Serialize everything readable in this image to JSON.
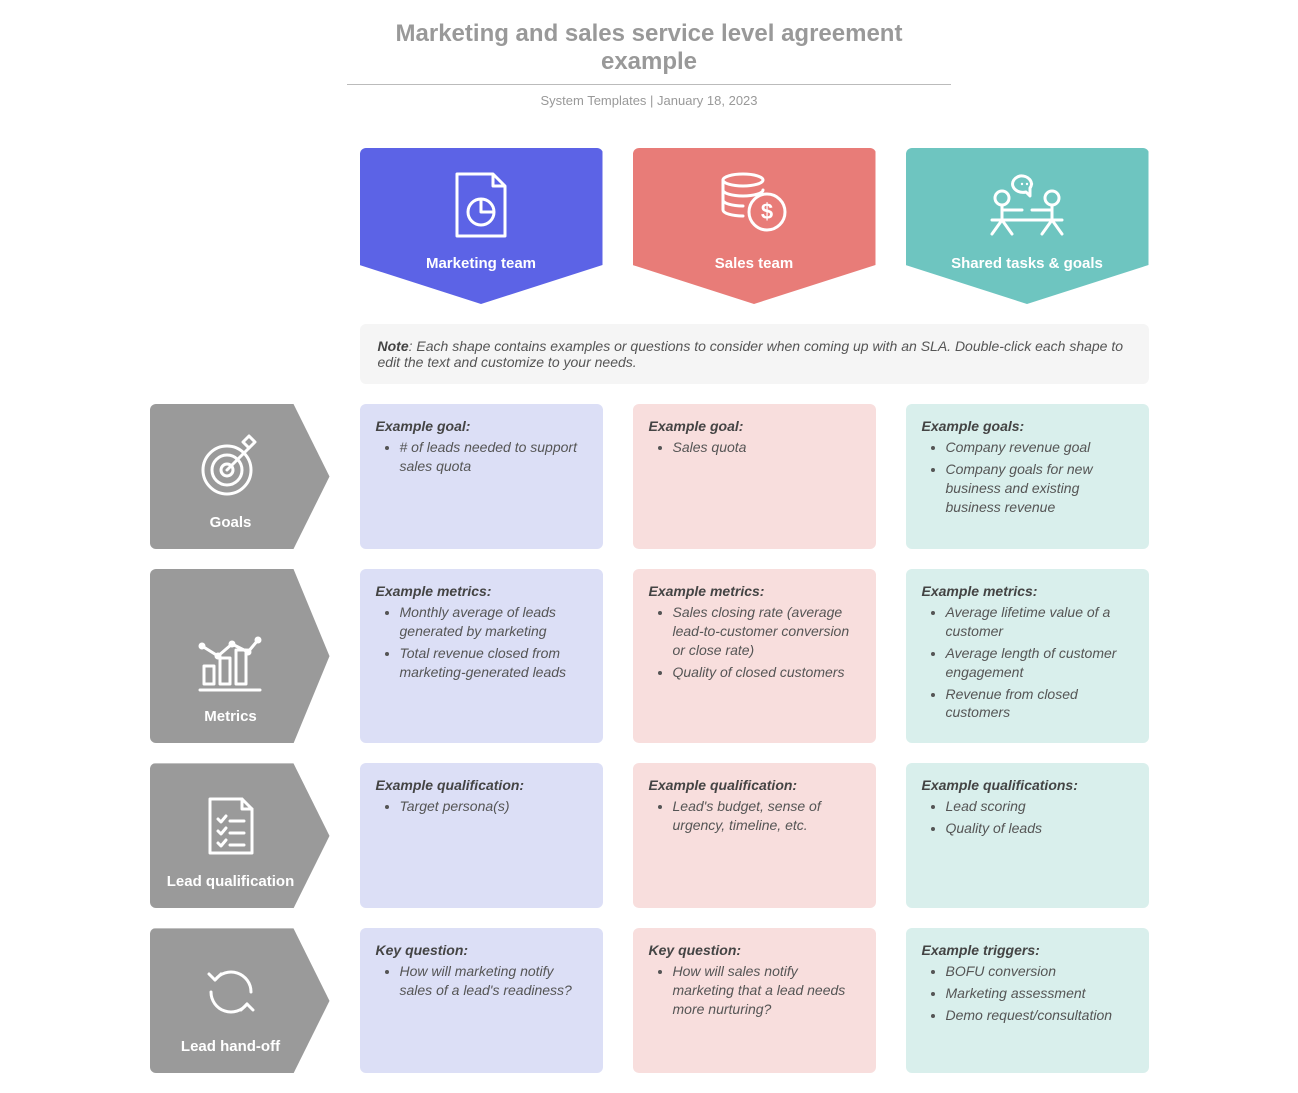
{
  "header": {
    "title": "Marketing and sales service level agreement example",
    "source": "System Templates",
    "sep": " | ",
    "date": "January 18, 2023"
  },
  "columns": {
    "spacer": "",
    "marketing": {
      "label": "Marketing team"
    },
    "sales": {
      "label": "Sales team"
    },
    "shared": {
      "label": "Shared tasks & goals"
    }
  },
  "note": {
    "lead": "Note",
    "text": ": Each shape contains examples or questions to consider when coming up with an SLA. Double-click each shape to edit the text and customize to your needs."
  },
  "rows": {
    "goals": {
      "label": "Goals",
      "marketing": {
        "lead": "Example goal:",
        "items": [
          "# of leads needed to support sales quota"
        ]
      },
      "sales": {
        "lead": "Example goal:",
        "items": [
          "Sales quota"
        ]
      },
      "shared": {
        "lead": "Example goals:",
        "items": [
          "Company revenue goal",
          "Company goals for new business and existing business revenue"
        ]
      }
    },
    "metrics": {
      "label": "Metrics",
      "marketing": {
        "lead": "Example metrics:",
        "items": [
          "Monthly average of leads generated by marketing",
          "Total revenue closed from marketing-generated leads"
        ]
      },
      "sales": {
        "lead": "Example metrics:",
        "items": [
          "Sales closing rate (average lead-to-customer conversion or close rate)",
          "Quality of closed customers"
        ]
      },
      "shared": {
        "lead": "Example metrics:",
        "items": [
          "Average lifetime value of a customer",
          "Average length of customer engagement",
          "Revenue from closed customers"
        ]
      }
    },
    "leadqual": {
      "label": "Lead qualification",
      "marketing": {
        "lead": "Example qualification:",
        "items": [
          "Target persona(s)"
        ]
      },
      "sales": {
        "lead": "Example qualification:",
        "items": [
          "Lead's budget, sense of urgency, timeline, etc."
        ]
      },
      "shared": {
        "lead": "Example qualifications:",
        "items": [
          "Lead scoring",
          "Quality of leads"
        ]
      }
    },
    "handoff": {
      "label": "Lead hand-off",
      "marketing": {
        "lead": "Key question:",
        "items": [
          "How will marketing notify sales of a lead's readiness?"
        ]
      },
      "sales": {
        "lead": "Key question:",
        "items": [
          "How will sales notify marketing that a lead needs more nurturing?"
        ]
      },
      "shared": {
        "lead": "Example triggers:",
        "items": [
          "BOFU conversion",
          "Marketing assessment",
          "Demo request/consultation"
        ]
      }
    }
  }
}
